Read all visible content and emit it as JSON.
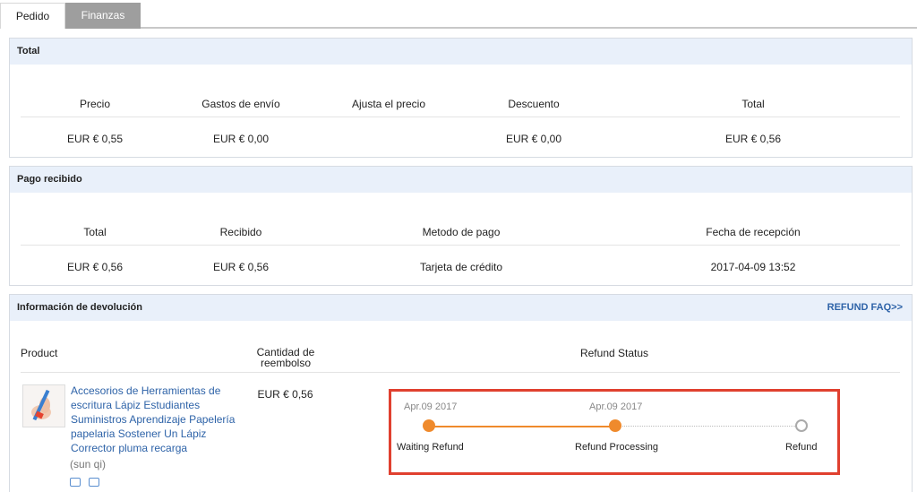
{
  "tabs": [
    {
      "label": "Pedido",
      "active": false
    },
    {
      "label": "Finanzas",
      "active": true
    }
  ],
  "total_panel": {
    "title": "Total",
    "headers": [
      "Precio",
      "Gastos de envío",
      "Ajusta el precio",
      "Descuento",
      "Total"
    ],
    "values": [
      "EUR € 0,55",
      "EUR € 0,00",
      "",
      "EUR € 0,00",
      "EUR € 0,56"
    ]
  },
  "payment_panel": {
    "title": "Pago recibido",
    "headers": [
      "Total",
      "Recibido",
      "Metodo de pago",
      "Fecha de recepción"
    ],
    "values": [
      "EUR € 0,56",
      "EUR € 0,56",
      "Tarjeta de crédito",
      "2017-04-09 13:52"
    ]
  },
  "refund_panel": {
    "title": "Información de devolución",
    "faq_link": "REFUND FAQ>>",
    "headers": {
      "product": "Product",
      "amount_line1": "Cantidad de",
      "amount_line2": "reembolso",
      "status": "Refund Status"
    },
    "item": {
      "name": "Accesorios de Herramientas de escritura Lápiz Estudiantes Suministros Aprendizaje Papelería papelaria Sostener Un Lápiz Corrector pluma recarga",
      "seller": "(sun qi)",
      "amount": "EUR € 0,56"
    },
    "timeline": {
      "steps": [
        {
          "date": "Apr.09 2017",
          "label": "Waiting Refund",
          "done": true
        },
        {
          "date": "Apr.09 2017",
          "label": "Refund Processing",
          "done": true
        },
        {
          "date": "",
          "label": "Refund",
          "done": false
        }
      ]
    }
  },
  "colors": {
    "accent_orange": "#ef8a2c",
    "highlight_red": "#e0402f",
    "link_blue": "#2e63a8",
    "panel_header_bg": "#e9f0fa"
  }
}
